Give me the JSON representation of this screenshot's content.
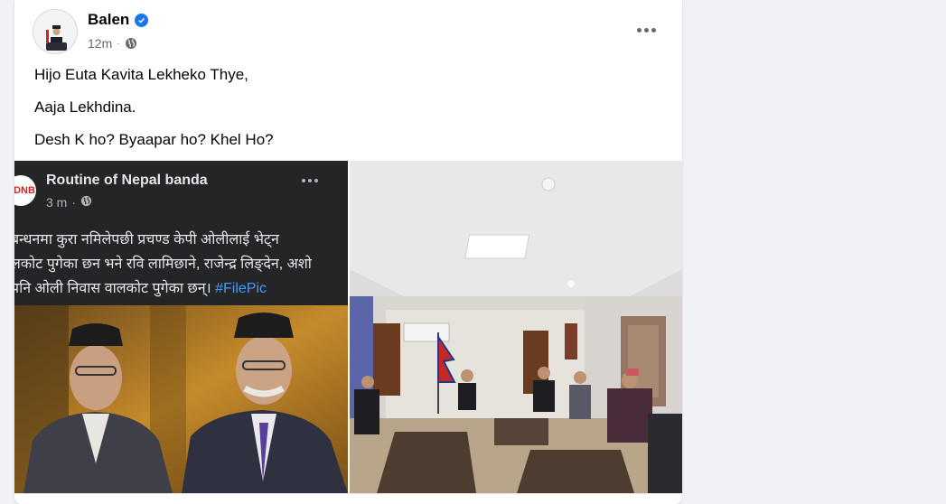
{
  "post": {
    "author": "Balen",
    "time": "12m",
    "text_lines": [
      "Hijo Euta Kavita Lekheko Thye,",
      "Aaja Lekhdina.",
      "Desh K ho? Byaapar ho? Khel Ho?"
    ]
  },
  "shared_post": {
    "page_name": "Routine of Nepal banda",
    "avatar_text": "DNB",
    "time": "3 m",
    "text_lines": [
      "बन्धनमा कुरा नमिलेपछी प्रचण्ड केपी ओलीलाई भेट्न",
      "लकोट पुगेका छन भने रवि लामिछाने, राजेन्द्र लिङ्देन, अशो",
      "पनि ओली निवास वालकोट पुगेका छन्।"
    ],
    "hashtag": "#FilePic"
  },
  "colors": {
    "link": "#4599ff",
    "verified": "#1877f2",
    "dark_card": "#242526"
  }
}
